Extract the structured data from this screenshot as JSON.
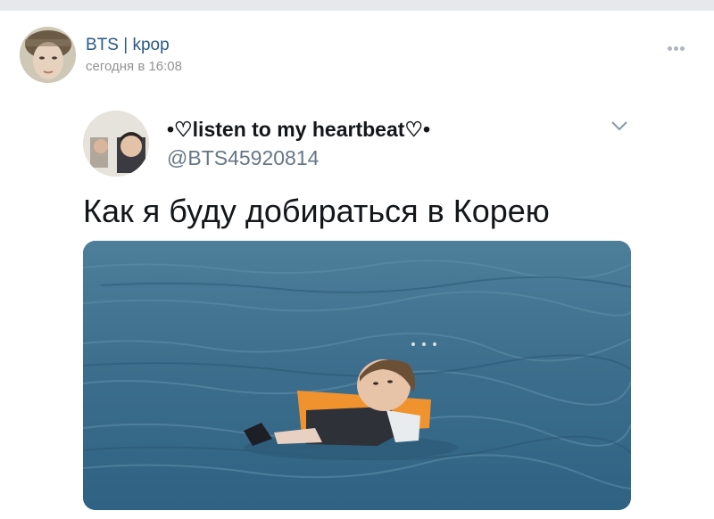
{
  "post": {
    "group_name": "BTS | kpop",
    "time": "сегодня в 16:08",
    "more_icon": "more-dots-icon"
  },
  "tweet": {
    "display_name": "•♡listen to my heartbeat♡•",
    "handle": "@BTS45920814",
    "text": "Как я буду добираться в Корею",
    "chevron_icon": "chevron-down-icon"
  },
  "colors": {
    "link": "#2a5885",
    "meta": "#939393",
    "handle": "#657786",
    "water": "#3c6d8c",
    "life_jacket": "#f0922e"
  }
}
